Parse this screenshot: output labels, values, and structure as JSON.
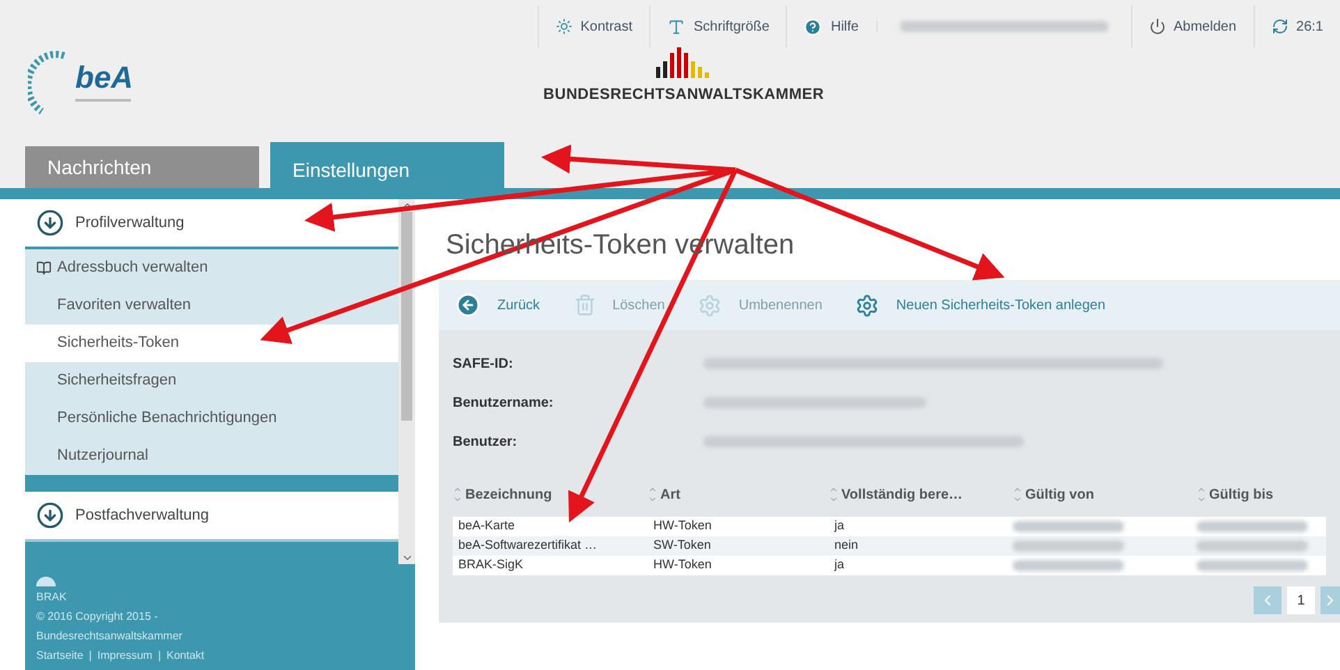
{
  "header": {
    "links": [
      {
        "kind": "contrast",
        "label": "Kontrast"
      },
      {
        "kind": "fontsize",
        "label": "Schriftgröße"
      },
      {
        "kind": "help",
        "label": "Hilfe"
      },
      {
        "kind": "redacted"
      },
      {
        "kind": "logout",
        "label": "Abmelden"
      },
      {
        "kind": "timer",
        "label": "26:1"
      }
    ],
    "logo": "beA",
    "brand": "BUNDESRECHTSANWALTSKAMMER"
  },
  "tabs": [
    {
      "label": "Nachrichten",
      "selected": false
    },
    {
      "label": "Einstellungen",
      "selected": true
    }
  ],
  "sidebar": {
    "sections": [
      {
        "title": "Profilverwaltung",
        "expanded": true,
        "items": [
          {
            "label": "Adressbuch verwalten",
            "kind": "book",
            "selected": false
          },
          {
            "label": "Favoriten verwalten",
            "selected": false
          },
          {
            "label": "Sicherheits-Token",
            "selected": true
          },
          {
            "label": "Sicherheitsfragen",
            "selected": false
          },
          {
            "label": "Persönliche Benachrichtigungen",
            "selected": false
          },
          {
            "label": "Nutzerjournal",
            "selected": false
          }
        ]
      },
      {
        "title": "Postfachverwaltung",
        "expanded": false
      }
    ],
    "footer": {
      "org": "BRAK",
      "copyright": "© 2016 Copyright 2015 -",
      "name": "Bundesrechtsanwaltskammer",
      "links": [
        "Startseite",
        "Impressum",
        "Kontakt"
      ],
      "separator": "|"
    }
  },
  "main": {
    "title": "Sicherheits-Token verwalten",
    "actions": [
      {
        "kind": "back",
        "label": "Zurück",
        "disabled": false
      },
      {
        "kind": "delete",
        "label": "Löschen",
        "disabled": true
      },
      {
        "kind": "gear",
        "label": "Umbenennen",
        "disabled": true
      },
      {
        "kind": "gear",
        "label": "Neuen Sicherheits-Token anlegen",
        "disabled": false
      }
    ],
    "info": [
      {
        "label": "SAFE-ID:"
      },
      {
        "label": "Benutzername:"
      },
      {
        "label": "Benutzer:"
      }
    ],
    "table": {
      "columns": [
        "Bezeichnung",
        "Art",
        "Vollständig bere…",
        "Gültig von",
        "Gültig bis"
      ],
      "rows": [
        {
          "cells": [
            "beA-Karte",
            "HW-Token",
            "ja"
          ]
        },
        {
          "cells": [
            "beA-Softwarezertifikat …",
            "SW-Token",
            "nein"
          ]
        },
        {
          "cells": [
            "BRAK-SigK",
            "HW-Token",
            "ja"
          ]
        }
      ]
    },
    "pagination": {
      "page": "1"
    }
  }
}
